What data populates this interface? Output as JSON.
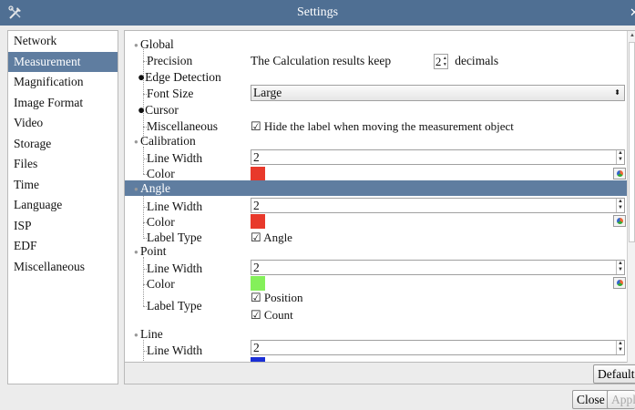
{
  "window": {
    "title": "Settings"
  },
  "sidebar": {
    "items": [
      {
        "label": "Network"
      },
      {
        "label": "Measurement",
        "selected": true
      },
      {
        "label": "Magnification"
      },
      {
        "label": "Image Format"
      },
      {
        "label": "Video"
      },
      {
        "label": "Storage"
      },
      {
        "label": "Files"
      },
      {
        "label": "Time"
      },
      {
        "label": "Language"
      },
      {
        "label": "ISP"
      },
      {
        "label": "EDF"
      },
      {
        "label": "Miscellaneous"
      }
    ]
  },
  "tree": {
    "global": {
      "label": "Global",
      "precision_label": "Precision",
      "precision_prefix": "The Calculation results keep",
      "precision_value": "2",
      "precision_suffix": "decimals",
      "edge_detection_label": "Edge Detection",
      "font_size_label": "Font Size",
      "font_size_value": "Large",
      "cursor_label": "Cursor",
      "misc_label": "Miscellaneous",
      "misc_check": "☑ Hide the label when moving the measurement object"
    },
    "calibration": {
      "label": "Calibration",
      "line_width_label": "Line Width",
      "line_width_value": "2",
      "color_label": "Color",
      "color": "#e8392b"
    },
    "angle": {
      "label": "Angle",
      "line_width_label": "Line Width",
      "line_width_value": "2",
      "color_label": "Color",
      "color": "#e8392b",
      "label_type_label": "Label Type",
      "label_type_check": "☑ Angle"
    },
    "point": {
      "label": "Point",
      "line_width_label": "Line Width",
      "line_width_value": "2",
      "color_label": "Color",
      "color": "#84f05a",
      "label_type_label": "Label Type",
      "check_position": "☑ Position",
      "check_count": "☑ Count"
    },
    "line": {
      "label": "Line",
      "line_width_label": "Line Width",
      "line_width_value": "2",
      "color": "#1a2fd6"
    }
  },
  "buttons": {
    "default_label": "Default",
    "close_label": "Close",
    "apply_label": "Appl"
  },
  "colors": {
    "titlebar": "#4f6f93",
    "selection": "#5f7da0"
  }
}
